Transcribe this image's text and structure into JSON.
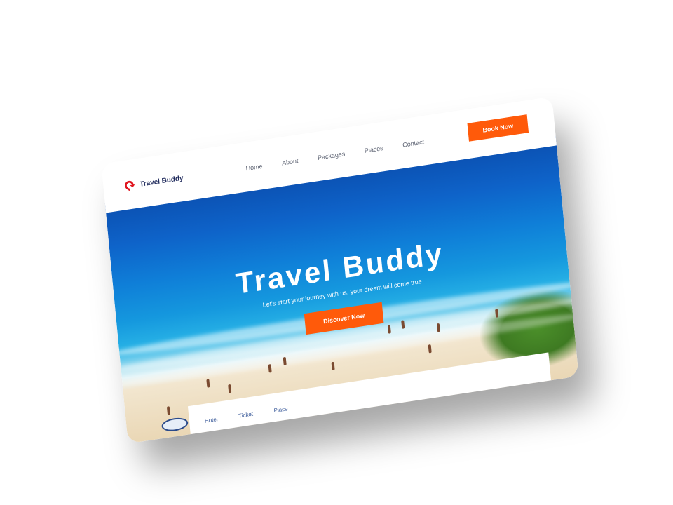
{
  "header": {
    "brand": "Travel Buddy",
    "nav": [
      "Home",
      "About",
      "Packages",
      "Places",
      "Contact"
    ],
    "book_label": "Book Now"
  },
  "hero": {
    "title": "Travel Buddy",
    "subtitle": "Let's start your journey with us, your dream will come true",
    "cta_label": "Discover Now"
  },
  "tabs": [
    "Hotel",
    "Ticket",
    "Place"
  ],
  "colors": {
    "accent": "#ff5a0a",
    "brand_text": "#1f2a5c",
    "logo": "#e0141e"
  },
  "icons": {
    "logo": "location-pin-icon"
  }
}
